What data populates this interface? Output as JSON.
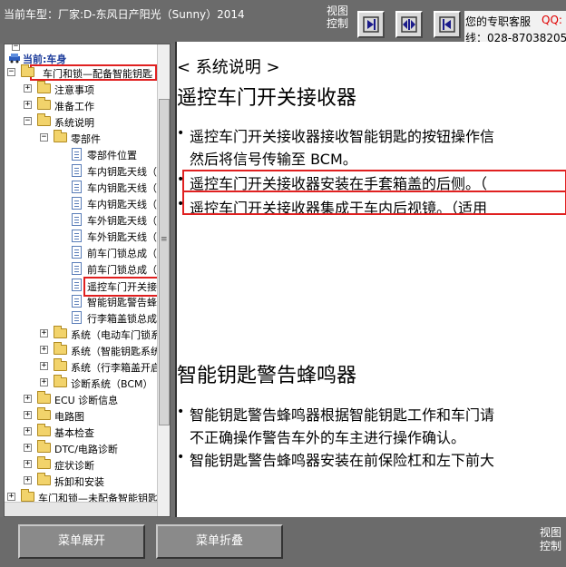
{
  "header": {
    "car_model": "当前车型：厂家:D-东风日产阳光（Sunny）2014",
    "view_control": "视图控制",
    "service_label": "您的专职客服",
    "service_qq": "QQ:",
    "service_phone": "线：028-87038205"
  },
  "tree": {
    "current": "当前:车身",
    "items": [
      {
        "label": "车门和锁—配备智能钥匙",
        "exp": "−"
      },
      {
        "label": "注意事项",
        "exp": "+"
      },
      {
        "label": "准备工作",
        "exp": "+"
      },
      {
        "label": "系统说明",
        "exp": "−"
      },
      {
        "label": "零部件",
        "exp": "−"
      },
      {
        "label": "零部件位置"
      },
      {
        "label": "车内钥匙天线（"
      },
      {
        "label": "车内钥匙天线（"
      },
      {
        "label": "车内钥匙天线（"
      },
      {
        "label": "车外钥匙天线（"
      },
      {
        "label": "车外钥匙天线（"
      },
      {
        "label": "前车门锁总成（"
      },
      {
        "label": "前车门锁总成（"
      },
      {
        "label": "遥控车门开关接"
      },
      {
        "label": "智能钥匙警告蜂"
      },
      {
        "label": "行李箱盖锁总成"
      },
      {
        "label": "系统（电动车门锁系",
        "exp": "+"
      },
      {
        "label": "系统（智能钥匙系统",
        "exp": "+"
      },
      {
        "label": "系统（行李箱盖开启",
        "exp": "+"
      },
      {
        "label": "诊断系统（BCM）",
        "exp": "+"
      },
      {
        "label": "ECU 诊断信息",
        "exp": "+"
      },
      {
        "label": "电路图",
        "exp": "+"
      },
      {
        "label": "基本检查",
        "exp": "+"
      },
      {
        "label": "DTC/电路诊断",
        "exp": "+"
      },
      {
        "label": "症状诊断",
        "exp": "+"
      },
      {
        "label": "拆卸和安装",
        "exp": "+"
      },
      {
        "label": "车门和锁—未配备智能钥匙",
        "exp": "+"
      }
    ]
  },
  "content": {
    "section_title": "< 系统说明 >",
    "heading1": "遥控车门开关接收器",
    "para1_line1": "遥控车门开关接收器接收智能钥匙的按钮操作信",
    "para1_line2": "然后将信号传输至 BCM。",
    "para2": "遥控车门开关接收器安装在手套箱盖的后侧。（",
    "para3": "遥控车门开关接收器集成于车内后视镜。（适用",
    "heading2": "智能钥匙警告蜂鸣器",
    "para4_line1": "智能钥匙警告蜂鸣器根据智能钥匙工作和车门请",
    "para4_line2": "不正确操作警告车外的车主进行操作确认。",
    "para5": "智能钥匙警告蜂鸣器安装在前保险杠和左下前大",
    "bullet": "•"
  },
  "footer": {
    "expand_label": "菜单展开",
    "collapse_label": "菜单折叠",
    "view_control": "视图控制"
  },
  "colors": {
    "highlight": "#e02020",
    "qq": "#e00000",
    "bar_bg": "#6b6b6b"
  }
}
